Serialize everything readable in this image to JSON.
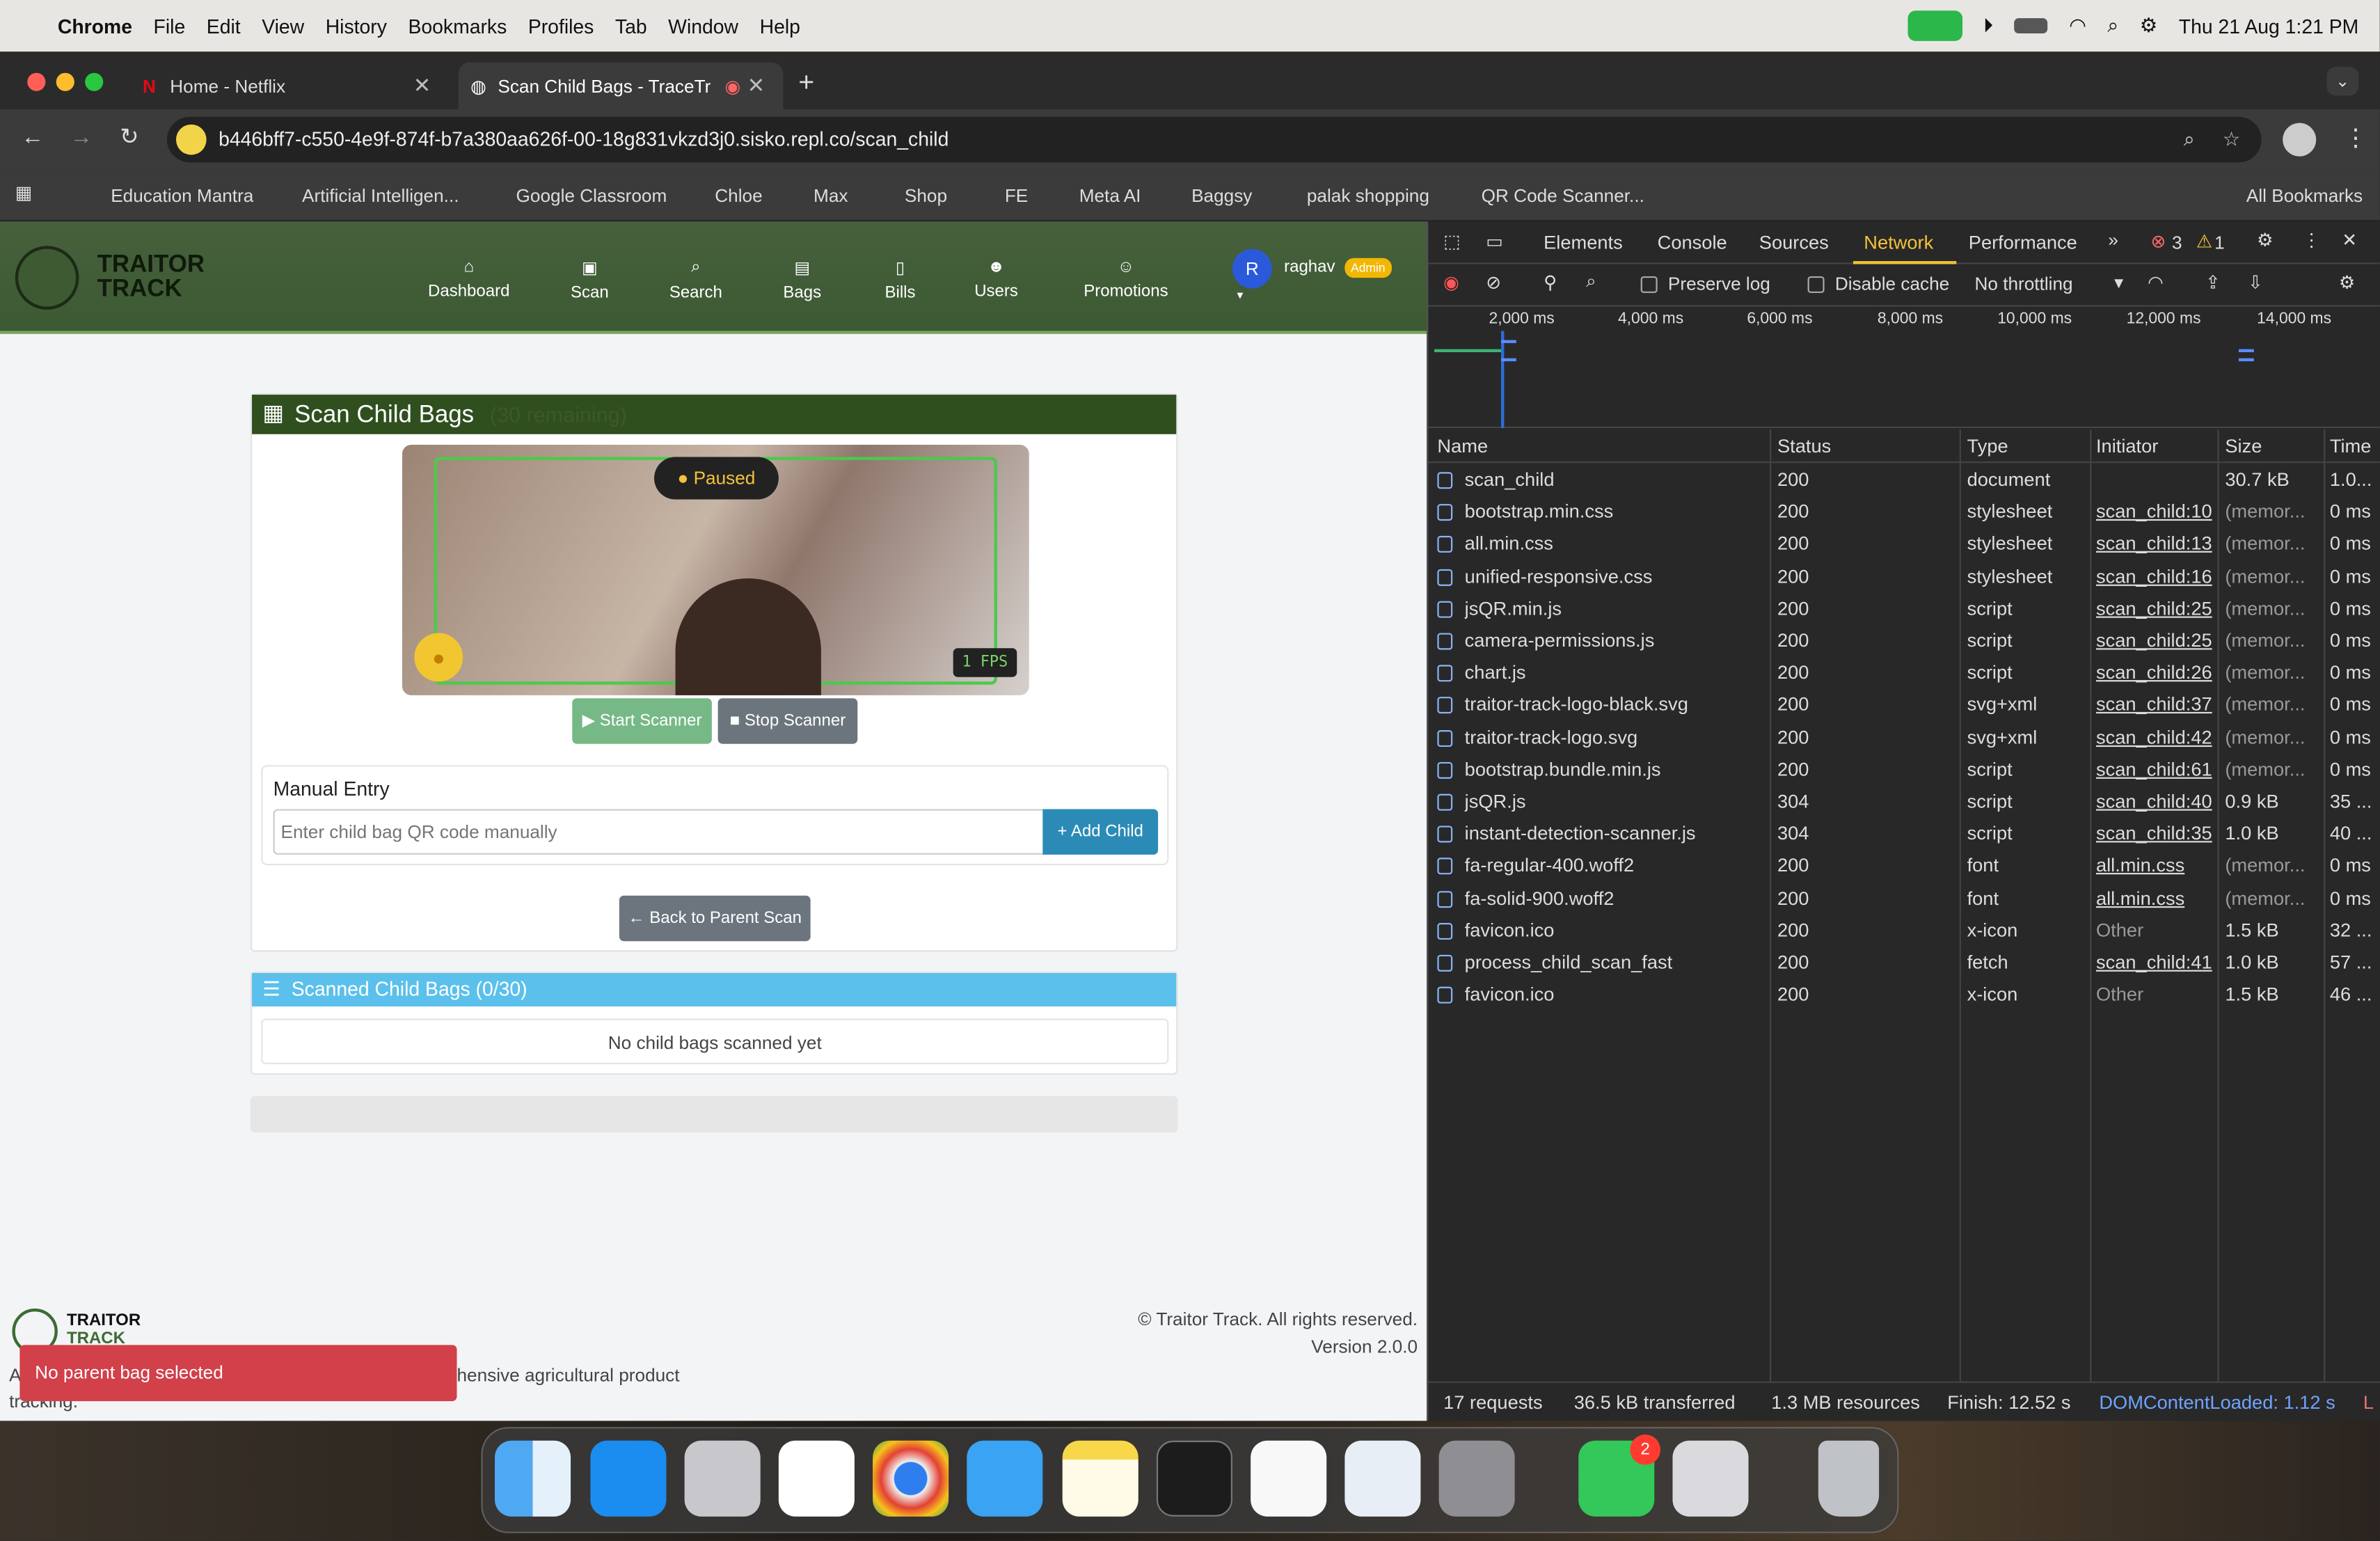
{
  "menubar": {
    "app": "Chrome",
    "items": [
      "File",
      "Edit",
      "View",
      "History",
      "Bookmarks",
      "Profiles",
      "Tab",
      "Window",
      "Help"
    ],
    "datetime": "Thu 21 Aug  1:21 PM"
  },
  "tabs": [
    {
      "title": "Home - Netflix"
    },
    {
      "title": "Scan Child Bags - TraceTr"
    }
  ],
  "address": {
    "url": "b446bff7-c550-4e9f-874f-b7a380aa626f-00-18g831vkzd3j0.sisko.repl.co/scan_child"
  },
  "bookmarks": [
    "Education Mantra",
    "Artificial Intelligen...",
    "Google Classroom",
    "Chloe",
    "Max",
    "Shop",
    "FE",
    "Meta AI",
    "Baggsy",
    "palak shopping",
    "QR Code Scanner...",
    "All Bookmarks"
  ],
  "site": {
    "brand_line1": "TRAITOR",
    "brand_line2": "TRACK",
    "nav": [
      "Dashboard",
      "Scan",
      "Search",
      "Bags",
      "Bills",
      "Users",
      "Promotions"
    ],
    "user_initial": "R",
    "user_name": "raghav",
    "user_role": "Admin"
  },
  "scan": {
    "title": "Scan Child Bags",
    "remaining": "(30 remaining)",
    "status": "Paused",
    "fps": "1 FPS",
    "start_label": "Start Scanner",
    "stop_label": "Stop Scanner",
    "manual_title": "Manual Entry",
    "manual_placeholder": "Enter child bag QR code manually",
    "add_label": "Add Child",
    "back_label": "Back to Parent Scan"
  },
  "scanned": {
    "title": "Scanned Child Bags (0/30)",
    "empty": "No child bags scanned yet"
  },
  "footer": {
    "brand_line1": "TRAITOR",
    "brand_line2": "TRACK",
    "copyright": "© Traitor Track. All rights reserved.",
    "version": "Version 2.0.0",
    "desc_a": "A",
    "desc": "hensive agricultural product",
    "desc2": "tracking.",
    "toast": "No parent bag selected"
  },
  "devtools": {
    "tabs": [
      "Elements",
      "Console",
      "Sources",
      "Network",
      "Performance"
    ],
    "errors": "3",
    "warnings": "1",
    "preserve": "Preserve log",
    "disable": "Disable cache",
    "throttle": "No throttling",
    "timeline": [
      "2,000 ms",
      "4,000 ms",
      "6,000 ms",
      "8,000 ms",
      "10,000 ms",
      "12,000 ms",
      "14,000 ms"
    ],
    "columns": [
      "Name",
      "Status",
      "Type",
      "Initiator",
      "Size",
      "Time"
    ],
    "rows": [
      [
        "scan_child",
        "200",
        "document",
        "",
        "30.7 kB",
        "1.0..."
      ],
      [
        "bootstrap.min.css",
        "200",
        "stylesheet",
        "scan_child:10",
        "(memor...",
        "0 ms"
      ],
      [
        "all.min.css",
        "200",
        "stylesheet",
        "scan_child:13",
        "(memor...",
        "0 ms"
      ],
      [
        "unified-responsive.css",
        "200",
        "stylesheet",
        "scan_child:16",
        "(memor...",
        "0 ms"
      ],
      [
        "jsQR.min.js",
        "200",
        "script",
        "scan_child:25",
        "(memor...",
        "0 ms"
      ],
      [
        "camera-permissions.js",
        "200",
        "script",
        "scan_child:25",
        "(memor...",
        "0 ms"
      ],
      [
        "chart.js",
        "200",
        "script",
        "scan_child:26",
        "(memor...",
        "0 ms"
      ],
      [
        "traitor-track-logo-black.svg",
        "200",
        "svg+xml",
        "scan_child:37",
        "(memor...",
        "0 ms"
      ],
      [
        "traitor-track-logo.svg",
        "200",
        "svg+xml",
        "scan_child:42",
        "(memor...",
        "0 ms"
      ],
      [
        "bootstrap.bundle.min.js",
        "200",
        "script",
        "scan_child:61",
        "(memor...",
        "0 ms"
      ],
      [
        "jsQR.js",
        "304",
        "script",
        "scan_child:40",
        "0.9 kB",
        "35 ..."
      ],
      [
        "instant-detection-scanner.js",
        "304",
        "script",
        "scan_child:35",
        "1.0 kB",
        "40 ..."
      ],
      [
        "fa-regular-400.woff2",
        "200",
        "font",
        "all.min.css",
        "(memor...",
        "0 ms"
      ],
      [
        "fa-solid-900.woff2",
        "200",
        "font",
        "all.min.css",
        "(memor...",
        "0 ms"
      ],
      [
        "favicon.ico",
        "200",
        "x-icon",
        "Other",
        "1.5 kB",
        "32 ..."
      ],
      [
        "process_child_scan_fast",
        "200",
        "fetch",
        "scan_child:41",
        "1.0 kB",
        "57 ..."
      ],
      [
        "favicon.ico",
        "200",
        "x-icon",
        "Other",
        "1.5 kB",
        "46 ..."
      ]
    ],
    "summary": {
      "requests": "17 requests",
      "transferred": "36.5 kB transferred",
      "resources": "1.3 MB resources",
      "finish": "Finish: 12.52 s",
      "dcl": "DOMContentLoaded: 1.12 s",
      "l": "L"
    }
  },
  "dock": {
    "badge": "2"
  }
}
